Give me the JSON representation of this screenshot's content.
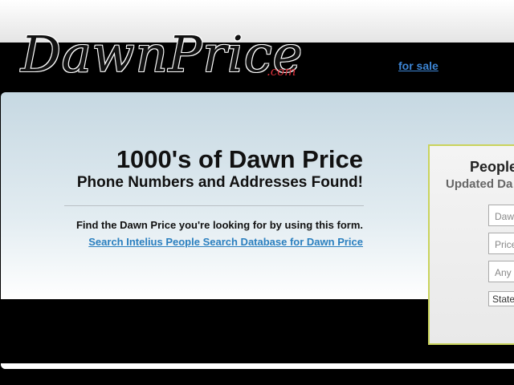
{
  "header": {
    "logo_text": "DawnPrice",
    "logo_suffix": ".com",
    "for_sale_link": "for sale"
  },
  "hero": {
    "headline": "1000's of Dawn Price",
    "subheadline": "Phone Numbers and Addresses Found!",
    "form_intro": "Find the Dawn Price you're looking for by using this form.",
    "search_link": "Search Intelius People Search Database for Dawn Price"
  },
  "search_form": {
    "title": "People",
    "subtitle": "Updated Da",
    "first_name_value": "Daw",
    "last_name_value": "Price",
    "city_placeholder": "Any c",
    "state_selected": "State"
  },
  "colors": {
    "link_blue": "#2a7fbf",
    "form_border": "#c9d35c",
    "logo_dotcom": "#d9303a"
  }
}
